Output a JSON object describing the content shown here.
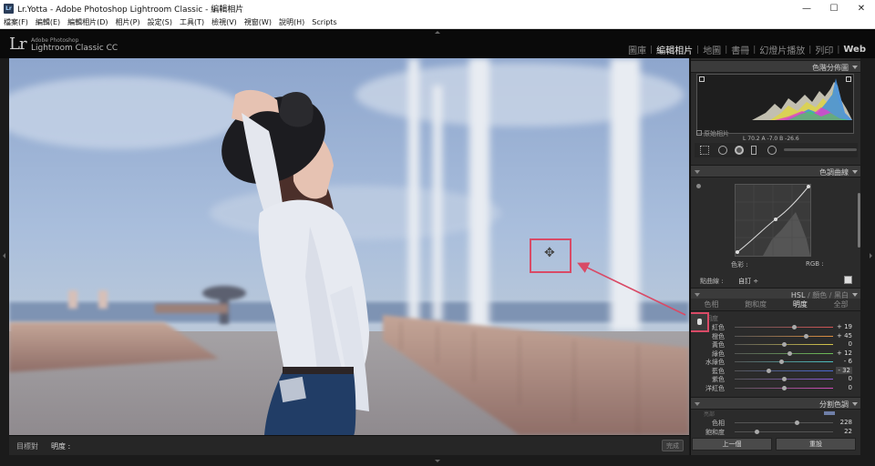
{
  "window": {
    "title": "Lr.Yotta - Adobe Photoshop Lightroom Classic - 編輯相片",
    "app_icon": "Lr",
    "controls": [
      "—",
      "☐",
      "✕"
    ]
  },
  "menu": [
    "檔案(F)",
    "編輯(E)",
    "編輯相片(D)",
    "相片(P)",
    "設定(S)",
    "工具(T)",
    "檢視(V)",
    "視窗(W)",
    "說明(H)",
    "Scripts"
  ],
  "identity": {
    "logo": "Lr",
    "adobe": "Adobe Photoshop",
    "product": "Lightroom Classic CC"
  },
  "modules": [
    {
      "label": "圖庫",
      "active": false
    },
    {
      "label": "編輯相片",
      "active": true
    },
    {
      "label": "地圖",
      "active": false
    },
    {
      "label": "書冊",
      "active": false
    },
    {
      "label": "幻燈片播放",
      "active": false
    },
    {
      "label": "列印",
      "active": false
    },
    {
      "label": "Web",
      "active": false
    }
  ],
  "toolbar": {
    "target_label": "目標對",
    "target_value": "明度 :",
    "done": "完成"
  },
  "panels": {
    "histogram": {
      "title": "色階分佈圖",
      "readout": "L 70.2  A -7.0  B -26.6",
      "original_photo": "原始相片"
    },
    "tone_curve": {
      "title": "色調曲線",
      "label_left": "色彩 :",
      "label_right": "RGB :",
      "channel_label": "點曲線 :",
      "channel_value": "自訂 ÷"
    },
    "hsl": {
      "header": "HSL / 顏色 / 黑白",
      "header_hsl": "HSL",
      "header_color": "顏色",
      "header_bw": "黑白",
      "tabs": [
        {
          "label": "色相",
          "active": false
        },
        {
          "label": "飽和度",
          "active": false
        },
        {
          "label": "明度",
          "active": true
        },
        {
          "label": "全部",
          "active": false
        }
      ],
      "subheading": "明度",
      "sliders": [
        {
          "label": "紅色",
          "value": "+ 19",
          "position": 0.6,
          "color": "#d55555"
        },
        {
          "label": "橙色",
          "value": "+ 45",
          "position": 0.72,
          "color": "#e09040"
        },
        {
          "label": "黃色",
          "value": "0",
          "position": 0.5,
          "color": "#d8c84a"
        },
        {
          "label": "綠色",
          "value": "+ 12",
          "position": 0.56,
          "color": "#6cbf56"
        },
        {
          "label": "水綠色",
          "value": "- 6",
          "position": 0.47,
          "color": "#4cc2c2"
        },
        {
          "label": "藍色",
          "value": "- 32",
          "position": 0.34,
          "color": "#4a6ad8",
          "active": true
        },
        {
          "label": "紫色",
          "value": "0",
          "position": 0.5,
          "color": "#8a5ad8"
        },
        {
          "label": "洋紅色",
          "value": "0",
          "position": 0.5,
          "color": "#d04ab8"
        }
      ]
    },
    "split_toning": {
      "title": "分割色調",
      "subheading": "亮部",
      "sliders": [
        {
          "label": "色相",
          "value": "228",
          "position": 0.63
        },
        {
          "label": "飽和度",
          "value": "22",
          "position": 0.22
        }
      ]
    }
  },
  "buttons": {
    "previous": "上一個",
    "reset": "重設"
  }
}
